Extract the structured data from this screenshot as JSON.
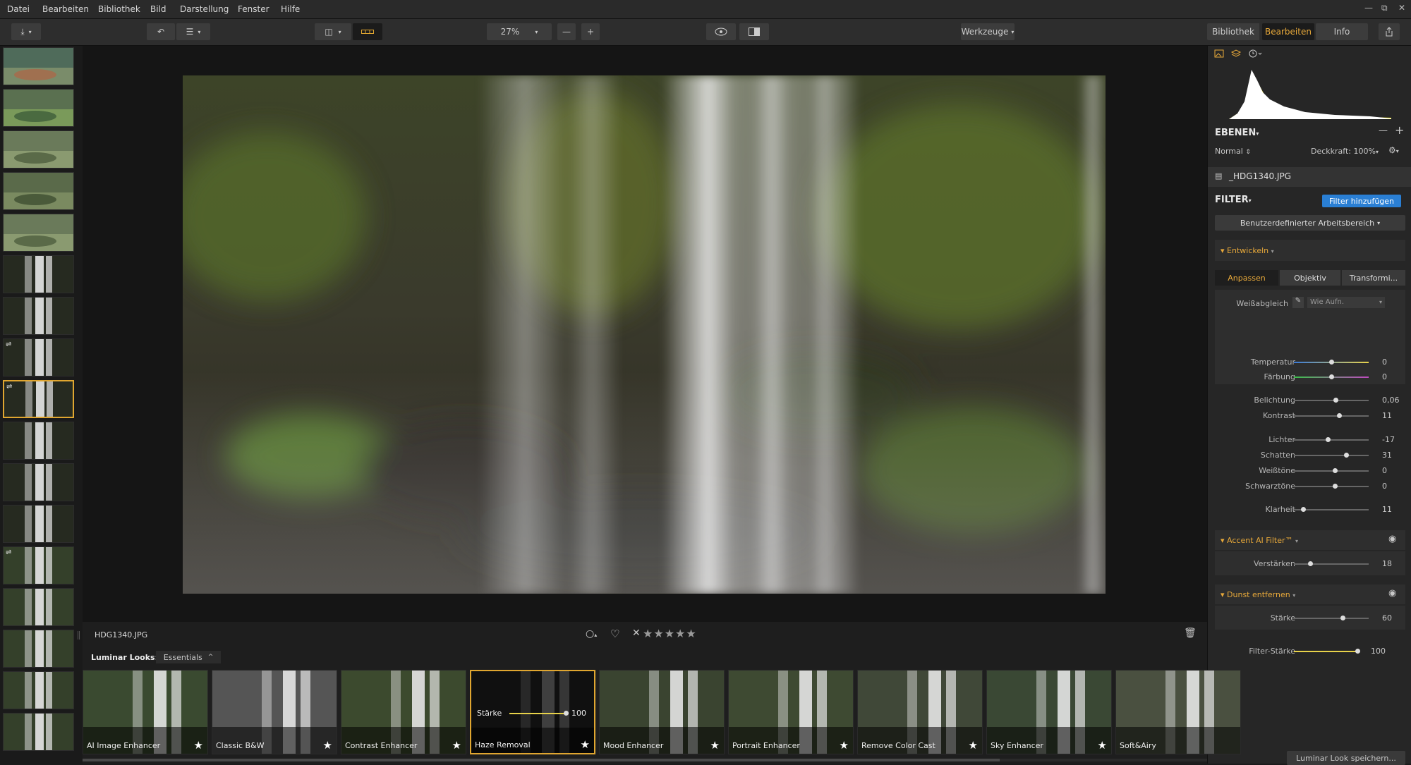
{
  "menu": [
    "Datei",
    "Bearbeiten",
    "Bibliothek",
    "Bild",
    "Darstellung",
    "Fenster",
    "Hilfe"
  ],
  "window_controls": {
    "minimize": "—",
    "maximize": "⧉",
    "close": "✕"
  },
  "toolbar": {
    "zoom": "27%",
    "zoom_out": "—",
    "zoom_in": "+",
    "tools_label": "Werkzeuge"
  },
  "top_tabs": {
    "library": "Bibliothek",
    "edit": "Bearbeiten",
    "info": "Info"
  },
  "filmstrip": {
    "selected_index": 8,
    "edited_indices": [
      7,
      8,
      12
    ],
    "edited_mark": "⇌"
  },
  "histogram": {
    "icons": [
      "image-icon",
      "layers-icon",
      "history-icon"
    ]
  },
  "layers": {
    "title": "EBENEN",
    "blend_mode": "Normal",
    "opacity": "Deckkraft: 100%",
    "layer_name": "_HDG1340.JPG",
    "remove": "—",
    "add": "+"
  },
  "filters": {
    "title": "FILTER",
    "add_button": "Filter hinzufügen",
    "workspace": "Benutzerdefinierter Arbeitsbereich",
    "develop": {
      "title": "Entwickeln",
      "tabs": [
        "Anpassen",
        "Objektiv",
        "Transformi..."
      ],
      "white_balance_label": "Weißabgleich",
      "white_balance_value": "Wie Aufn.",
      "groups": [
        [
          {
            "label": "Temperatur",
            "value": "0",
            "pos": 0.5
          },
          {
            "label": "Färbung",
            "value": "0",
            "pos": 0.5
          }
        ],
        [
          {
            "label": "Belichtung",
            "value": "0,06",
            "pos": 0.56
          },
          {
            "label": "Kontrast",
            "value": "11",
            "pos": 0.6
          }
        ],
        [
          {
            "label": "Lichter",
            "value": "-17",
            "pos": 0.45
          },
          {
            "label": "Schatten",
            "value": "31",
            "pos": 0.7
          },
          {
            "label": "Weißtöne",
            "value": "0",
            "pos": 0.55
          },
          {
            "label": "Schwarztöne",
            "value": "0",
            "pos": 0.55
          }
        ],
        [
          {
            "label": "Klarheit",
            "value": "11",
            "pos": 0.12
          }
        ]
      ]
    },
    "accent": {
      "title": "Accent AI Filter™",
      "label": "Verstärken",
      "value": "18",
      "pos": 0.22
    },
    "haze": {
      "title": "Dunst entfernen",
      "label": "Stärke",
      "value": "60",
      "pos": 0.65
    },
    "filter_strength": {
      "label": "Filter-Stärke",
      "value": "100",
      "pos": 1.0
    }
  },
  "info": {
    "filename": "HDG1340.JPG",
    "stars": "★★★★★",
    "reject": "✕",
    "flag": "○",
    "heart": "♡"
  },
  "looks": {
    "label": "Luminar Looks:",
    "category": "Essentials",
    "save_button": "Luminar Look speichern...",
    "items": [
      {
        "name": "AI Image Enhancer"
      },
      {
        "name": "Classic B&W"
      },
      {
        "name": "Contrast Enhancer"
      },
      {
        "name": "Haze Removal",
        "strength_label": "Stärke",
        "strength_value": "100"
      },
      {
        "name": "Mood Enhancer"
      },
      {
        "name": "Portrait Enhancer"
      },
      {
        "name": "Remove Color Cast"
      },
      {
        "name": "Sky Enhancer"
      },
      {
        "name": "Soft&Airy"
      }
    ]
  }
}
